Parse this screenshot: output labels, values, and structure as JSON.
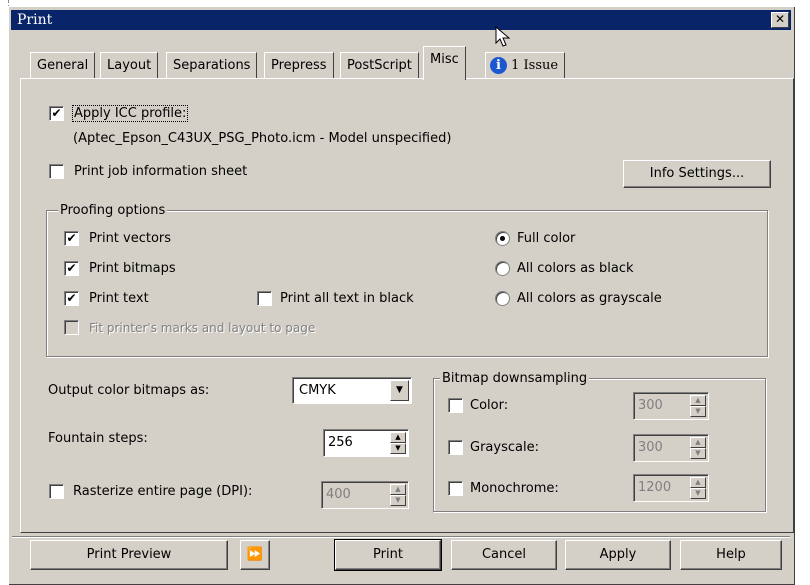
{
  "window": {
    "title": "Print",
    "close_glyph": "✕"
  },
  "tabs": [
    "General",
    "Layout",
    "Separations",
    "Prepress",
    "PostScript",
    "Misc",
    "1 Issue"
  ],
  "active_tab": "Misc",
  "misc": {
    "apply_icc_label": "Apply ICC profile:",
    "apply_icc_checked": true,
    "icc_profile_desc": "(Aptec_Epson_C43UX_PSG_Photo.icm - Model unspecified)",
    "print_job_info_label": "Print job information sheet",
    "print_job_info_checked": false,
    "info_settings_button": "Info Settings...",
    "proofing": {
      "title": "Proofing options",
      "print_vectors": "Print vectors",
      "print_bitmaps": "Print bitmaps",
      "print_text": "Print text",
      "print_all_text_black": "Print all text in black",
      "fit_marks": "Fit printer's marks and layout to page",
      "full_color": "Full color",
      "all_black": "All colors as black",
      "all_grayscale": "All colors as grayscale",
      "selected_color_mode": "Full color"
    },
    "output_color_label": "Output color bitmaps as:",
    "output_color_value": "CMYK",
    "fountain_steps_label": "Fountain steps:",
    "fountain_steps_value": "256",
    "rasterize_label": "Rasterize entire page (DPI):",
    "rasterize_value": "400",
    "bitmap_downsampling": {
      "title": "Bitmap downsampling",
      "color_label": "Color:",
      "color_value": "300",
      "grayscale_label": "Grayscale:",
      "grayscale_value": "300",
      "monochrome_label": "Monochrome:",
      "monochrome_value": "1200"
    }
  },
  "footer": {
    "print_preview": "Print Preview",
    "expand_glyph": "⏩",
    "print": "Print",
    "cancel": "Cancel",
    "apply": "Apply",
    "help": "Help"
  },
  "icons": {
    "issue_icon": "info-circle",
    "check": "✔"
  }
}
